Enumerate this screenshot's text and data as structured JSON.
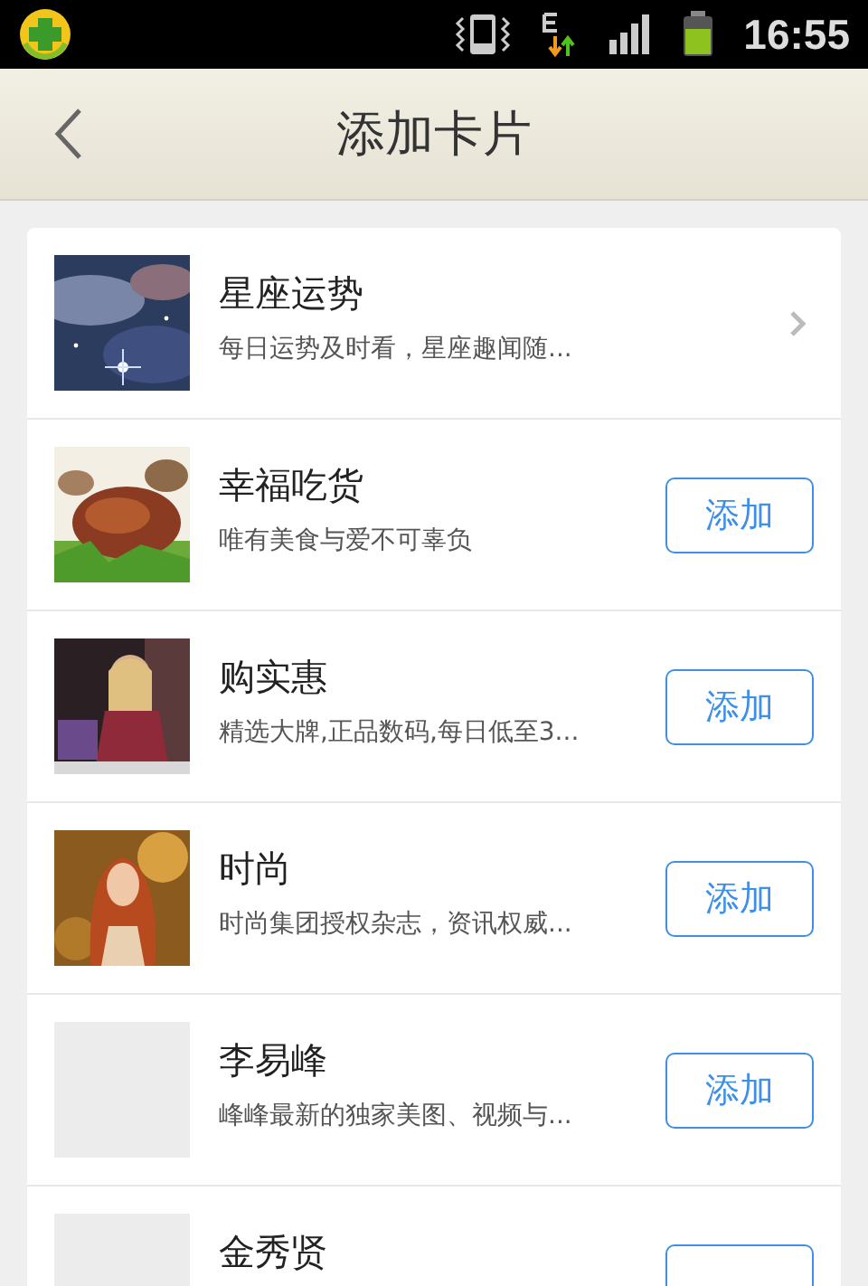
{
  "status_bar": {
    "time": "16:55"
  },
  "header": {
    "title": "添加卡片"
  },
  "cards": [
    {
      "kind": "arrow",
      "title": "星座运势",
      "description": "每日运势及时看，星座趣闻随..."
    },
    {
      "kind": "add",
      "title": "幸福吃货",
      "description": "唯有美食与爱不可辜负",
      "button": "添加"
    },
    {
      "kind": "add",
      "title": "购实惠",
      "description": "精选大牌,正品数码,每日低至3...",
      "button": "添加"
    },
    {
      "kind": "add",
      "title": "时尚",
      "description": "时尚集团授权杂志，资讯权威...",
      "button": "添加"
    },
    {
      "kind": "add",
      "image": {
        "kind": "placeholder"
      },
      "title": "李易峰",
      "description": "峰峰最新的独家美图、视频与...",
      "button": "添加"
    },
    {
      "kind": "add",
      "image": {
        "kind": "placeholder"
      },
      "title": "金秀贤"
    }
  ]
}
